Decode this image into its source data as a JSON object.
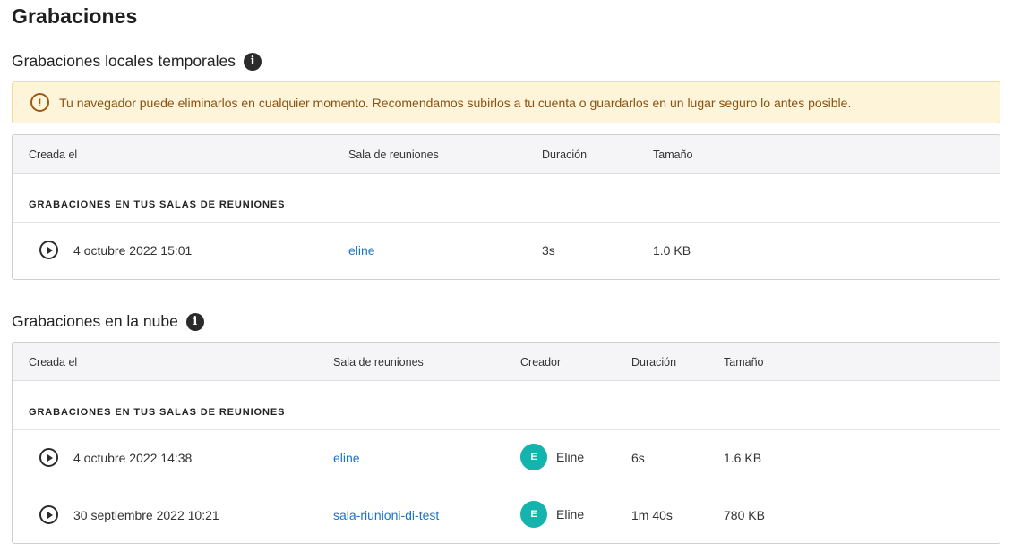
{
  "page": {
    "title": "Grabaciones"
  },
  "local": {
    "title": "Grabaciones locales temporales",
    "info_icon": "info-icon",
    "warning": {
      "icon": "warning-icon",
      "text": "Tu navegador puede eliminarlos en cualquier momento. Recomendamos subirlos a tu cuenta o guardarlos en un lugar seguro lo antes posible."
    },
    "columns": [
      "Creada el",
      "Sala de reuniones",
      "Duración",
      "Tamaño"
    ],
    "group_label": "GRABACIONES EN TUS SALAS DE REUNIONES",
    "rows": [
      {
        "created": "4 octubre 2022 15:01",
        "room": "eline",
        "duration": "3s",
        "size": "1.0 KB"
      }
    ]
  },
  "cloud": {
    "title": "Grabaciones en la nube",
    "info_icon": "info-icon",
    "columns": [
      "Creada el",
      "Sala de reuniones",
      "Creador",
      "Duración",
      "Tamaño"
    ],
    "group_label": "GRABACIONES EN TUS SALAS DE REUNIONES",
    "rows": [
      {
        "created": "4 octubre 2022 14:38",
        "room": "eline",
        "creator_initial": "E",
        "creator": "Eline",
        "duration": "6s",
        "size": "1.6 KB"
      },
      {
        "created": "30 septiembre 2022 10:21",
        "room": "sala-riunioni-di-test",
        "creator_initial": "E",
        "creator": "Eline",
        "duration": "1m 40s",
        "size": "780 KB"
      }
    ]
  },
  "colors": {
    "link": "#1a73c9",
    "avatar": "#14b3ad",
    "warning_bg": "#fdf4d9",
    "warning_text": "#8a5212"
  }
}
